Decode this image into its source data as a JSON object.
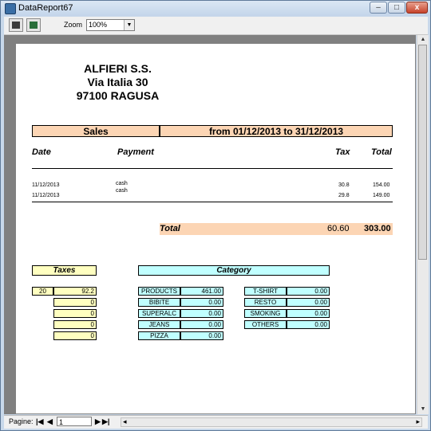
{
  "window": {
    "title": "DataReport67",
    "min_label": "–",
    "max_label": "□",
    "close_label": "x"
  },
  "toolbar": {
    "zoom_label": "Zoom",
    "zoom_value": "100%",
    "zoom_arrow": "▼"
  },
  "report": {
    "company": {
      "name": "ALFIERI S.S.",
      "address": "Via Italia 30",
      "city": "97100 RAGUSA"
    },
    "sales_label": "Sales",
    "period": "from  01/12/2013 to 31/12/2013",
    "columns": {
      "date": "Date",
      "payment": "Payment",
      "tax": "Tax",
      "total": "Total"
    },
    "rows": [
      {
        "date": "11/12/2013",
        "payment": "cash",
        "tax": "30.8",
        "total": "154.00"
      },
      {
        "date": "11/12/2013",
        "payment": "cash",
        "tax": "29.8",
        "total": "149.00"
      }
    ],
    "total_label": "Total",
    "total_tax": "60.60",
    "total_amount": "303.00",
    "taxes_label": "Taxes",
    "category_label": "Category",
    "taxes": [
      {
        "rate": "20",
        "value": "92.2"
      },
      {
        "rate": "",
        "value": "0"
      },
      {
        "rate": "",
        "value": "0"
      },
      {
        "rate": "",
        "value": "0"
      },
      {
        "rate": "",
        "value": "0"
      }
    ],
    "categories_left": [
      {
        "name": "PRODUCTS",
        "value": "461.00"
      },
      {
        "name": "BIBITE",
        "value": "0.00"
      },
      {
        "name": "SUPERALC",
        "value": "0.00"
      },
      {
        "name": "JEANS",
        "value": "0.00"
      },
      {
        "name": "PIZZA",
        "value": "0.00"
      }
    ],
    "categories_right": [
      {
        "name": "T-SHIRT",
        "value": "0.00"
      },
      {
        "name": "RESTO",
        "value": "0.00"
      },
      {
        "name": "SMOKING",
        "value": "0.00"
      },
      {
        "name": "OTHERS",
        "value": "0.00"
      }
    ]
  },
  "status": {
    "pagine_label": "Pagine:",
    "first": "|◀",
    "prev": "◀",
    "page": "1",
    "next": "▶",
    "last": "▶|",
    "hscroll_left": "◂",
    "hscroll_right": "▸"
  },
  "scroll": {
    "up": "▲",
    "down": "▼"
  }
}
